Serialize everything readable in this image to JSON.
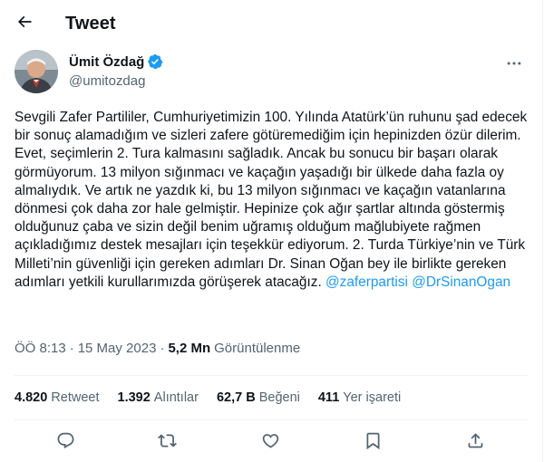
{
  "header": {
    "title": "Tweet",
    "back_icon": "arrow-left-icon"
  },
  "author": {
    "name": "Ümit Özdağ",
    "handle": "@umitozdag",
    "verified": true,
    "verified_color": "#1d9bf0"
  },
  "tweet": {
    "body": "Sevgili Zafer Partililer, Cumhuriyetimizin 100. Yılında Atatürk’ün ruhunu şad edecek bir sonuç alamadığım ve sizleri zafere götüremediğim için hepinizden özür dilerim. Evet, seçimlerin 2. Tura kalmasını sağladık. Ancak bu sonucu bir başarı olarak görmüyorum. 13 milyon sığınmacı ve kaçağın yaşadığı bir ülkede daha fazla oy almalıydık. Ve artık ne yazdık ki, bu 13 milyon sığınmacı ve kaçağın vatanlarına dönmesi çok daha zor hale gelmiştir. Hepinize çok ağır şartlar altında göstermiş olduğunuz çaba ve sizin değil benim uğramış olduğum mağlubiyete rağmen açıkladığımız destek mesajları için teşekkür ediyorum. 2. Turda Türkiye’nin ve Türk Milleti’nin güvenliği için gereken adımları Dr. Sinan Oğan bey ile birlikte gereken adımları yetkili kurullarımızda görüşerek atacağız.",
    "mention_1": "@zaferpartisi",
    "mention_2": "@DrSinanOgan",
    "mention_color": "#1d9bf0"
  },
  "meta": {
    "time": "ÖÖ 8:13",
    "separator": "·",
    "date": "15 May 2023",
    "views_count": "5,2 Mn",
    "views_label": "Görüntülenme"
  },
  "stats": {
    "retweets_count": "4.820",
    "retweets_label": "Retweet",
    "quotes_count": "1.392",
    "quotes_label": "Alıntılar",
    "likes_count": "62,7 B",
    "likes_label": "Beğeni",
    "bookmarks_count": "411",
    "bookmarks_label": "Yer işareti"
  },
  "actions": [
    "reply-icon",
    "retweet-icon",
    "like-icon",
    "share-icon"
  ],
  "colors": {
    "text": "#0f1419",
    "secondary": "#536471",
    "border": "#eff3f4",
    "accent": "#1d9bf0"
  }
}
